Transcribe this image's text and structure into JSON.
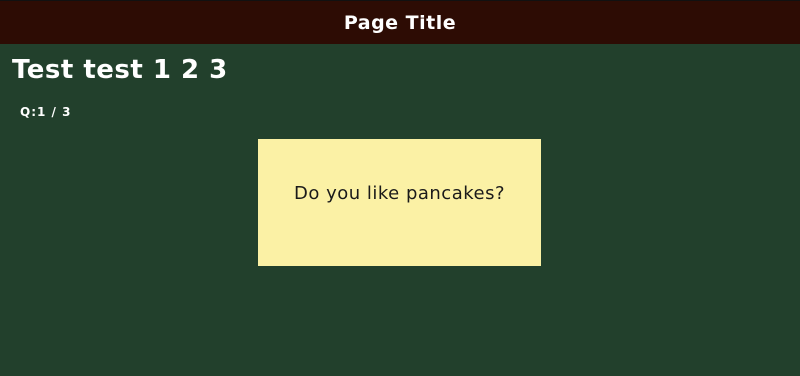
{
  "header": {
    "title": "Page Title"
  },
  "quiz": {
    "title": "Test test 1 2 3",
    "counter": "Q:1 / 3",
    "question": "Do you like pancakes?"
  },
  "colors": {
    "background": "#22402c",
    "header": "#2d0c04",
    "card": "#fbf1a5"
  }
}
